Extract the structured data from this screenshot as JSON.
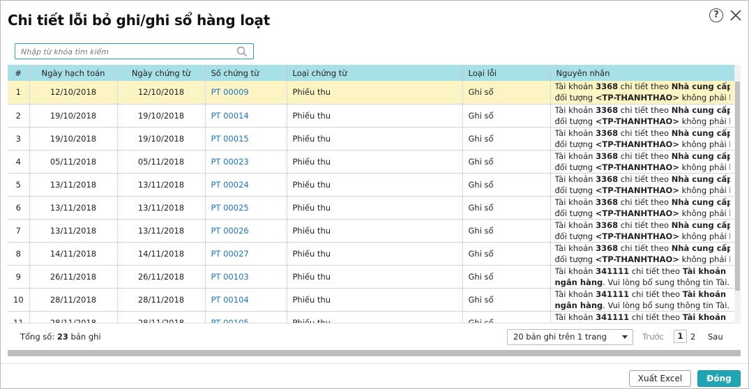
{
  "dialog": {
    "title": "Chi tiết lỗi bỏ ghi/ghi sổ hàng loạt",
    "help_glyph": "?"
  },
  "search": {
    "placeholder": "Nhập từ khóa tìm kiếm",
    "value": ""
  },
  "table": {
    "columns": [
      "#",
      "Ngày hạch toán",
      "Ngày chứng từ",
      "Số chứng từ",
      "Loại chứng từ",
      "Loại lỗi",
      "Nguyên nhân"
    ],
    "rows": [
      {
        "no": "1",
        "post_date": "12/10/2018",
        "doc_date": "12/10/2018",
        "doc_no": "PT 00009",
        "doc_type": "Phiếu thu",
        "error_type": "Ghi sổ",
        "cause": {
          "a": "Tài khoản ",
          "b": "3368",
          "c": " chi tiết theo ",
          "d": "Nhà cung cấp",
          "e": ",",
          "f": "đối tượng ",
          "g": "<TP-THANHTHAO>",
          "h": " không phải là..."
        }
      },
      {
        "no": "2",
        "post_date": "19/10/2018",
        "doc_date": "19/10/2018",
        "doc_no": "PT 00014",
        "doc_type": "Phiếu thu",
        "error_type": "Ghi sổ",
        "cause": {
          "a": "Tài khoản ",
          "b": "3368",
          "c": " chi tiết theo ",
          "d": "Nhà cung cấp",
          "e": ",",
          "f": "đối tượng ",
          "g": "<TP-THANHTHAO>",
          "h": " không phải là..."
        }
      },
      {
        "no": "3",
        "post_date": "19/10/2018",
        "doc_date": "19/10/2018",
        "doc_no": "PT 00015",
        "doc_type": "Phiếu thu",
        "error_type": "Ghi sổ",
        "cause": {
          "a": "Tài khoản ",
          "b": "3368",
          "c": " chi tiết theo ",
          "d": "Nhà cung cấp",
          "e": ",",
          "f": "đối tượng ",
          "g": "<TP-THANHTHAO>",
          "h": " không phải là..."
        }
      },
      {
        "no": "4",
        "post_date": "05/11/2018",
        "doc_date": "05/11/2018",
        "doc_no": "PT 00023",
        "doc_type": "Phiếu thu",
        "error_type": "Ghi sổ",
        "cause": {
          "a": "Tài khoản ",
          "b": "3368",
          "c": " chi tiết theo ",
          "d": "Nhà cung cấp",
          "e": ",",
          "f": "đối tượng ",
          "g": "<TP-THANHTHAO>",
          "h": " không phải là..."
        }
      },
      {
        "no": "5",
        "post_date": "13/11/2018",
        "doc_date": "13/11/2018",
        "doc_no": "PT 00024",
        "doc_type": "Phiếu thu",
        "error_type": "Ghi sổ",
        "cause": {
          "a": "Tài khoản ",
          "b": "3368",
          "c": " chi tiết theo ",
          "d": "Nhà cung cấp",
          "e": ",",
          "f": "đối tượng ",
          "g": "<TP-THANHTHAO>",
          "h": " không phải là..."
        }
      },
      {
        "no": "6",
        "post_date": "13/11/2018",
        "doc_date": "13/11/2018",
        "doc_no": "PT 00025",
        "doc_type": "Phiếu thu",
        "error_type": "Ghi sổ",
        "cause": {
          "a": "Tài khoản ",
          "b": "3368",
          "c": " chi tiết theo ",
          "d": "Nhà cung cấp",
          "e": ",",
          "f": "đối tượng ",
          "g": "<TP-THANHTHAO>",
          "h": " không phải là..."
        }
      },
      {
        "no": "7",
        "post_date": "13/11/2018",
        "doc_date": "13/11/2018",
        "doc_no": "PT 00026",
        "doc_type": "Phiếu thu",
        "error_type": "Ghi sổ",
        "cause": {
          "a": "Tài khoản ",
          "b": "3368",
          "c": " chi tiết theo ",
          "d": "Nhà cung cấp",
          "e": ",",
          "f": "đối tượng ",
          "g": "<TP-THANHTHAO>",
          "h": " không phải là..."
        }
      },
      {
        "no": "8",
        "post_date": "14/11/2018",
        "doc_date": "14/11/2018",
        "doc_no": "PT 00027",
        "doc_type": "Phiếu thu",
        "error_type": "Ghi sổ",
        "cause": {
          "a": "Tài khoản ",
          "b": "3368",
          "c": " chi tiết theo ",
          "d": "Nhà cung cấp",
          "e": ",",
          "f": "đối tượng ",
          "g": "<TP-THANHTHAO>",
          "h": " không phải là..."
        }
      },
      {
        "no": "9",
        "post_date": "26/11/2018",
        "doc_date": "26/11/2018",
        "doc_no": "PT 00103",
        "doc_type": "Phiếu thu",
        "error_type": "Ghi sổ",
        "cause": {
          "a": "Tài khoản ",
          "b": "341111",
          "c": " chi tiết theo ",
          "d": "Tài khoản",
          "e": "",
          "f": "",
          "g": "ngân hàng",
          "h": ". Vui lòng bổ sung thông tin Tài..."
        }
      },
      {
        "no": "10",
        "post_date": "28/11/2018",
        "doc_date": "28/11/2018",
        "doc_no": "PT 00104",
        "doc_type": "Phiếu thu",
        "error_type": "Ghi sổ",
        "cause": {
          "a": "Tài khoản ",
          "b": "341111",
          "c": " chi tiết theo ",
          "d": "Tài khoản",
          "e": "",
          "f": "",
          "g": "ngân hàng",
          "h": ". Vui lòng bổ sung thông tin Tài..."
        }
      },
      {
        "no": "11",
        "post_date": "28/11/2018",
        "doc_date": "28/11/2018",
        "doc_no": "PT 00105",
        "doc_type": "Phiếu thu",
        "error_type": "Ghi sổ",
        "cause": {
          "a": "Tài khoản ",
          "b": "341111",
          "c": " chi tiết theo ",
          "d": "Tài khoản",
          "e": "",
          "f": "",
          "g": "ngân hàng",
          "h": ". Vui lòng bổ sung thông tin Tài..."
        }
      }
    ],
    "selected_index": 0
  },
  "footer": {
    "total_label": "Tổng số: ",
    "total_count": "23",
    "total_suffix": " bản ghi",
    "page_size": "20 bản ghi trên 1 trang",
    "prev": "Trước",
    "pages": [
      "1",
      "2"
    ],
    "current_page": "1",
    "next": "Sau"
  },
  "actions": {
    "export": "Xuất Excel",
    "close": "Đóng"
  },
  "colors": {
    "header_bg": "#a7e0e6",
    "selected_row": "#fdf4c4",
    "link": "#1a73c8",
    "primary": "#22a5b2"
  }
}
